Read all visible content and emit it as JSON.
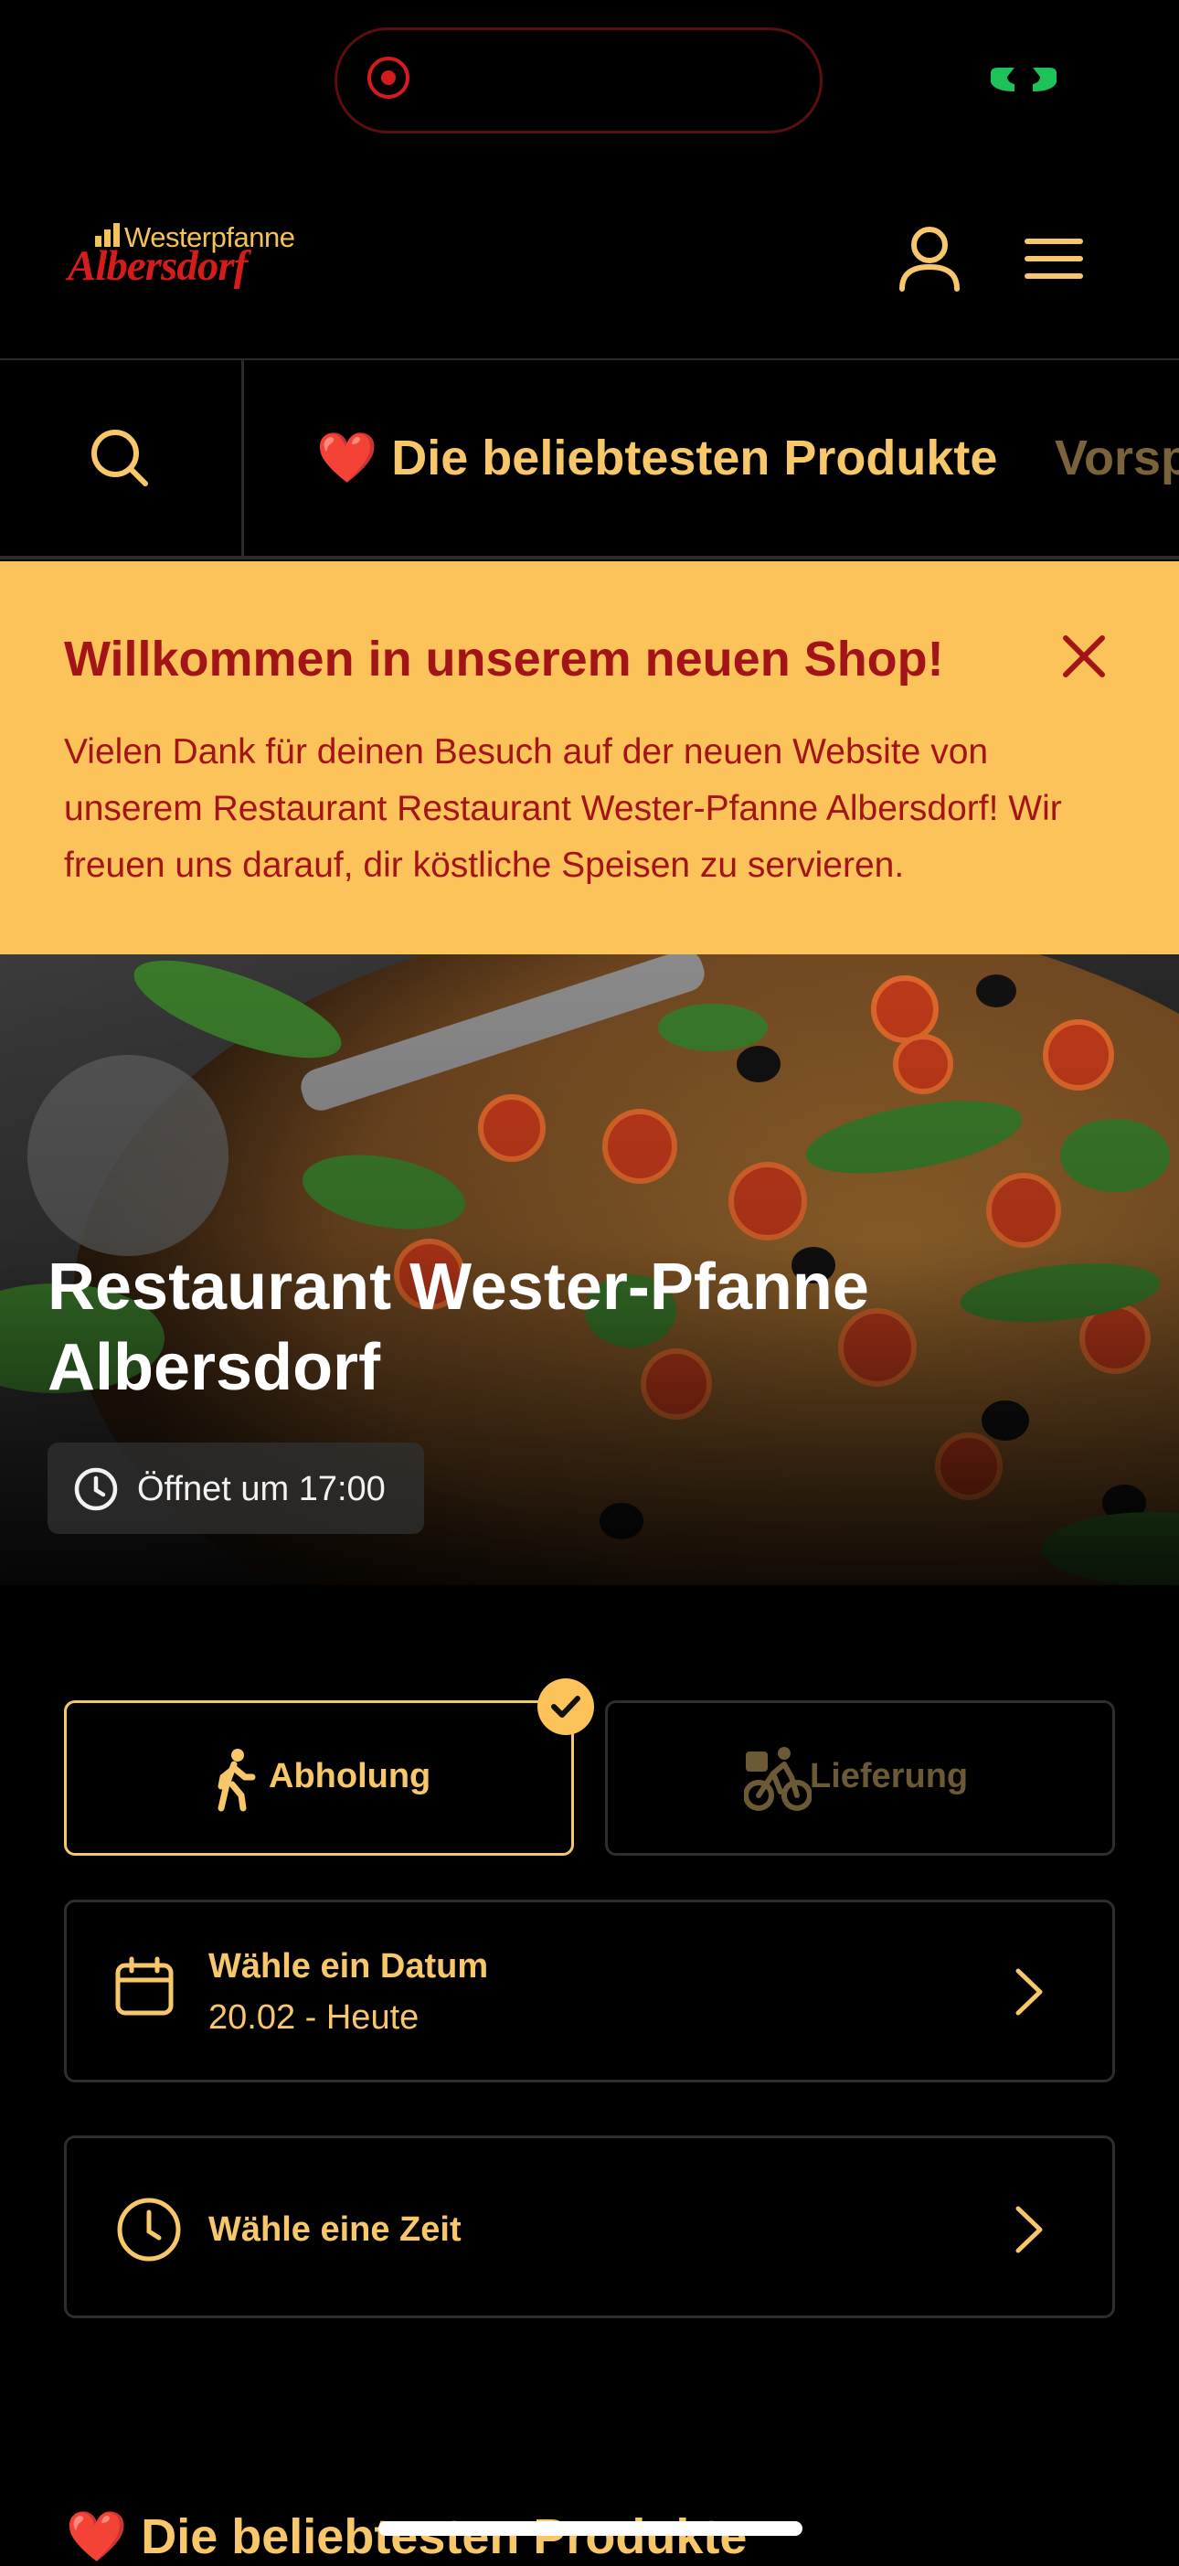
{
  "brand": {
    "logo_small": "Westerpfanne",
    "logo_big": "Albersdorf"
  },
  "header": {
    "account_icon": "user-icon",
    "menu_icon": "hamburger-menu-icon"
  },
  "nav": {
    "search_icon": "search-icon",
    "categories": [
      {
        "emoji": "❤️",
        "label": "Die beliebtesten Produkte",
        "active": true
      },
      {
        "label": "Vorsp",
        "active": false
      }
    ]
  },
  "banner": {
    "title": "Willkommen in unserem neuen Shop!",
    "text": "Vielen Dank für deinen Besuch auf der neuen Website von unserem Restaurant Restaurant Wester-Pfanne Albersdorf! Wir freuen uns darauf, dir köstliche Speisen zu servieren.",
    "close_icon": "close-icon"
  },
  "hero": {
    "restaurant_name": "Restaurant Wester-Pfanne Albersdorf",
    "opening_status": "Öffnet um 17:00"
  },
  "order": {
    "pickup_label": "Abholung",
    "delivery_label": "Lieferung",
    "selected": "pickup",
    "date_title": "Wähle ein Datum",
    "date_value": "20.02 - Heute",
    "time_title": "Wähle eine Zeit"
  },
  "section": {
    "title": "❤️ Die beliebtesten Produkte"
  },
  "colors": {
    "accent": "#f7c76a",
    "banner_bg": "#fcc35b",
    "banner_text": "#a31418",
    "brand_red": "#d41c1c",
    "background": "#000000"
  }
}
